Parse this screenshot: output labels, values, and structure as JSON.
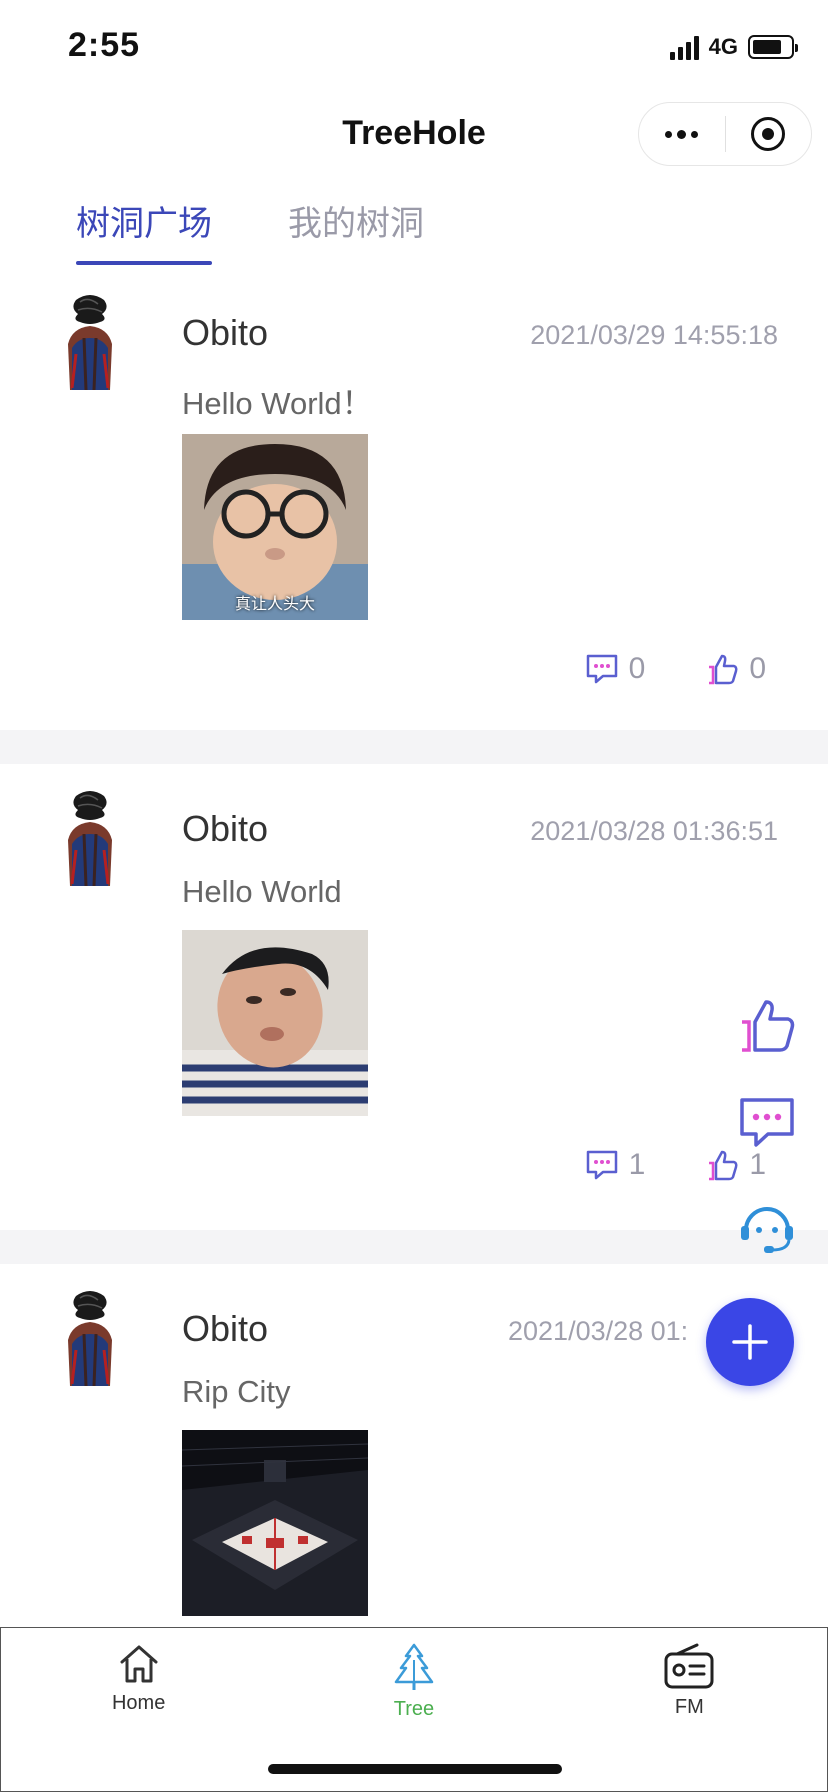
{
  "status_bar": {
    "time": "2:55",
    "network": "4G"
  },
  "nav": {
    "title": "TreeHole"
  },
  "tabs": [
    {
      "label": "树洞广场",
      "active": true
    },
    {
      "label": "我的树洞",
      "active": false
    }
  ],
  "posts": [
    {
      "username": "Obito",
      "timestamp": "2021/03/29 14:55:18",
      "content": "Hello World！",
      "photo_caption": "真让人头大",
      "comments": "0",
      "likes": "0"
    },
    {
      "username": "Obito",
      "timestamp": "2021/03/28 01:36:51",
      "content": "Hello World",
      "photo_caption": "",
      "comments": "1",
      "likes": "1"
    },
    {
      "username": "Obito",
      "timestamp": "2021/03/28 01:",
      "content": "Rip City",
      "photo_caption": "",
      "comments": "",
      "likes": ""
    }
  ],
  "tabbar": [
    {
      "label": "Home",
      "icon": "home-icon",
      "active": false
    },
    {
      "label": "Tree",
      "icon": "tree-icon",
      "active": true
    },
    {
      "label": "FM",
      "icon": "radio-icon",
      "active": false
    }
  ],
  "colors": {
    "accent": "#3b47b8",
    "fab": "#3a46e6",
    "active_tab": "#4caf50",
    "muted": "#a0a0ad"
  }
}
